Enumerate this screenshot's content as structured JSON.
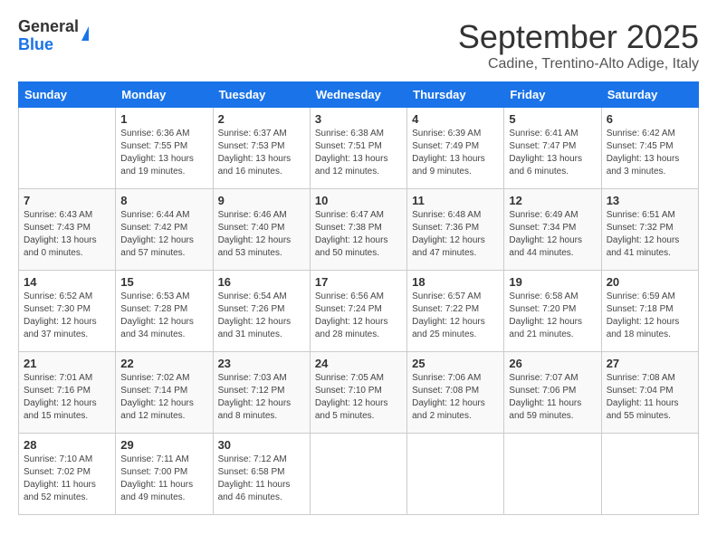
{
  "logo": {
    "general": "General",
    "blue": "Blue"
  },
  "title": "September 2025",
  "subtitle": "Cadine, Trentino-Alto Adige, Italy",
  "headers": [
    "Sunday",
    "Monday",
    "Tuesday",
    "Wednesday",
    "Thursday",
    "Friday",
    "Saturday"
  ],
  "weeks": [
    [
      {
        "day": "",
        "sunrise": "",
        "sunset": "",
        "daylight": ""
      },
      {
        "day": "1",
        "sunrise": "Sunrise: 6:36 AM",
        "sunset": "Sunset: 7:55 PM",
        "daylight": "Daylight: 13 hours and 19 minutes."
      },
      {
        "day": "2",
        "sunrise": "Sunrise: 6:37 AM",
        "sunset": "Sunset: 7:53 PM",
        "daylight": "Daylight: 13 hours and 16 minutes."
      },
      {
        "day": "3",
        "sunrise": "Sunrise: 6:38 AM",
        "sunset": "Sunset: 7:51 PM",
        "daylight": "Daylight: 13 hours and 12 minutes."
      },
      {
        "day": "4",
        "sunrise": "Sunrise: 6:39 AM",
        "sunset": "Sunset: 7:49 PM",
        "daylight": "Daylight: 13 hours and 9 minutes."
      },
      {
        "day": "5",
        "sunrise": "Sunrise: 6:41 AM",
        "sunset": "Sunset: 7:47 PM",
        "daylight": "Daylight: 13 hours and 6 minutes."
      },
      {
        "day": "6",
        "sunrise": "Sunrise: 6:42 AM",
        "sunset": "Sunset: 7:45 PM",
        "daylight": "Daylight: 13 hours and 3 minutes."
      }
    ],
    [
      {
        "day": "7",
        "sunrise": "Sunrise: 6:43 AM",
        "sunset": "Sunset: 7:43 PM",
        "daylight": "Daylight: 13 hours and 0 minutes."
      },
      {
        "day": "8",
        "sunrise": "Sunrise: 6:44 AM",
        "sunset": "Sunset: 7:42 PM",
        "daylight": "Daylight: 12 hours and 57 minutes."
      },
      {
        "day": "9",
        "sunrise": "Sunrise: 6:46 AM",
        "sunset": "Sunset: 7:40 PM",
        "daylight": "Daylight: 12 hours and 53 minutes."
      },
      {
        "day": "10",
        "sunrise": "Sunrise: 6:47 AM",
        "sunset": "Sunset: 7:38 PM",
        "daylight": "Daylight: 12 hours and 50 minutes."
      },
      {
        "day": "11",
        "sunrise": "Sunrise: 6:48 AM",
        "sunset": "Sunset: 7:36 PM",
        "daylight": "Daylight: 12 hours and 47 minutes."
      },
      {
        "day": "12",
        "sunrise": "Sunrise: 6:49 AM",
        "sunset": "Sunset: 7:34 PM",
        "daylight": "Daylight: 12 hours and 44 minutes."
      },
      {
        "day": "13",
        "sunrise": "Sunrise: 6:51 AM",
        "sunset": "Sunset: 7:32 PM",
        "daylight": "Daylight: 12 hours and 41 minutes."
      }
    ],
    [
      {
        "day": "14",
        "sunrise": "Sunrise: 6:52 AM",
        "sunset": "Sunset: 7:30 PM",
        "daylight": "Daylight: 12 hours and 37 minutes."
      },
      {
        "day": "15",
        "sunrise": "Sunrise: 6:53 AM",
        "sunset": "Sunset: 7:28 PM",
        "daylight": "Daylight: 12 hours and 34 minutes."
      },
      {
        "day": "16",
        "sunrise": "Sunrise: 6:54 AM",
        "sunset": "Sunset: 7:26 PM",
        "daylight": "Daylight: 12 hours and 31 minutes."
      },
      {
        "day": "17",
        "sunrise": "Sunrise: 6:56 AM",
        "sunset": "Sunset: 7:24 PM",
        "daylight": "Daylight: 12 hours and 28 minutes."
      },
      {
        "day": "18",
        "sunrise": "Sunrise: 6:57 AM",
        "sunset": "Sunset: 7:22 PM",
        "daylight": "Daylight: 12 hours and 25 minutes."
      },
      {
        "day": "19",
        "sunrise": "Sunrise: 6:58 AM",
        "sunset": "Sunset: 7:20 PM",
        "daylight": "Daylight: 12 hours and 21 minutes."
      },
      {
        "day": "20",
        "sunrise": "Sunrise: 6:59 AM",
        "sunset": "Sunset: 7:18 PM",
        "daylight": "Daylight: 12 hours and 18 minutes."
      }
    ],
    [
      {
        "day": "21",
        "sunrise": "Sunrise: 7:01 AM",
        "sunset": "Sunset: 7:16 PM",
        "daylight": "Daylight: 12 hours and 15 minutes."
      },
      {
        "day": "22",
        "sunrise": "Sunrise: 7:02 AM",
        "sunset": "Sunset: 7:14 PM",
        "daylight": "Daylight: 12 hours and 12 minutes."
      },
      {
        "day": "23",
        "sunrise": "Sunrise: 7:03 AM",
        "sunset": "Sunset: 7:12 PM",
        "daylight": "Daylight: 12 hours and 8 minutes."
      },
      {
        "day": "24",
        "sunrise": "Sunrise: 7:05 AM",
        "sunset": "Sunset: 7:10 PM",
        "daylight": "Daylight: 12 hours and 5 minutes."
      },
      {
        "day": "25",
        "sunrise": "Sunrise: 7:06 AM",
        "sunset": "Sunset: 7:08 PM",
        "daylight": "Daylight: 12 hours and 2 minutes."
      },
      {
        "day": "26",
        "sunrise": "Sunrise: 7:07 AM",
        "sunset": "Sunset: 7:06 PM",
        "daylight": "Daylight: 11 hours and 59 minutes."
      },
      {
        "day": "27",
        "sunrise": "Sunrise: 7:08 AM",
        "sunset": "Sunset: 7:04 PM",
        "daylight": "Daylight: 11 hours and 55 minutes."
      }
    ],
    [
      {
        "day": "28",
        "sunrise": "Sunrise: 7:10 AM",
        "sunset": "Sunset: 7:02 PM",
        "daylight": "Daylight: 11 hours and 52 minutes."
      },
      {
        "day": "29",
        "sunrise": "Sunrise: 7:11 AM",
        "sunset": "Sunset: 7:00 PM",
        "daylight": "Daylight: 11 hours and 49 minutes."
      },
      {
        "day": "30",
        "sunrise": "Sunrise: 7:12 AM",
        "sunset": "Sunset: 6:58 PM",
        "daylight": "Daylight: 11 hours and 46 minutes."
      },
      {
        "day": "",
        "sunrise": "",
        "sunset": "",
        "daylight": ""
      },
      {
        "day": "",
        "sunrise": "",
        "sunset": "",
        "daylight": ""
      },
      {
        "day": "",
        "sunrise": "",
        "sunset": "",
        "daylight": ""
      },
      {
        "day": "",
        "sunrise": "",
        "sunset": "",
        "daylight": ""
      }
    ]
  ]
}
